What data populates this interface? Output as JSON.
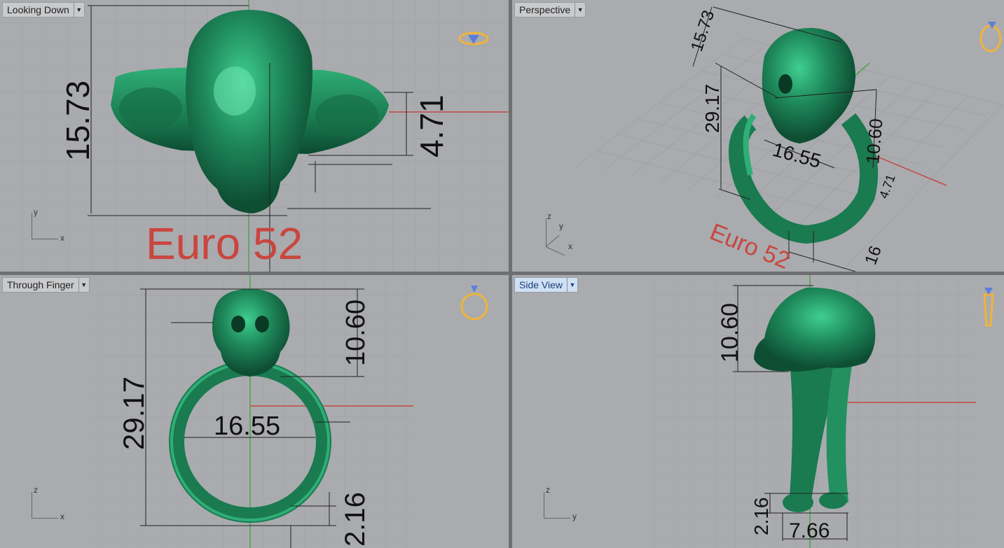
{
  "viewports": {
    "top_left": {
      "title": "Looking Down",
      "axes": [
        "y",
        "x"
      ]
    },
    "top_right": {
      "title": "Perspective",
      "axes": [
        "z",
        "y",
        "x"
      ]
    },
    "bottom_left": {
      "title": "Through Finger",
      "axes": [
        "z",
        "x"
      ]
    },
    "bottom_right": {
      "title": "Side View",
      "axes": [
        "z",
        "y"
      ]
    }
  },
  "dimensions": {
    "tl_height": "15.73",
    "tl_band": "4.71",
    "tr_skull": "15.73",
    "tr_total": "29.17",
    "tr_inner": "16.55",
    "tr_head": "10.60",
    "tr_band": "4.71",
    "tr_width": "16",
    "bl_head": "10.60",
    "bl_total": "29.17",
    "bl_inner": "16.55",
    "bl_band": "2.16",
    "br_head": "10.60",
    "br_band": "2.16",
    "br_width": "7.66"
  },
  "size_label": "Euro 52",
  "size_label_perspective": "Euro 52",
  "colors": {
    "model": "#1f8a5c",
    "grid": "#9fa1a4",
    "axis_red": "#c44a44",
    "axis_green": "#4fa34f",
    "label_red": "#c9463f",
    "icon": "#f0b43a"
  }
}
